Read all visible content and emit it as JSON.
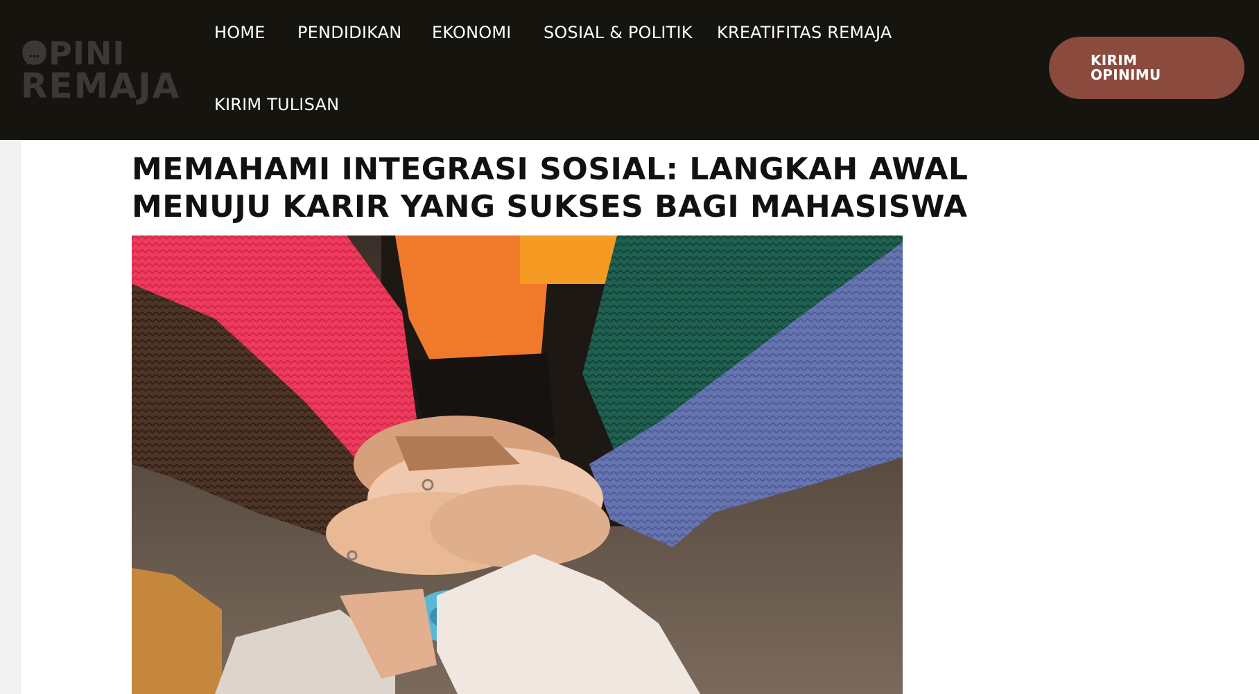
{
  "logo": {
    "line1": "OPINI",
    "line2": "REMAJA",
    "pin_dots": "..."
  },
  "nav": {
    "items": [
      {
        "label": "HOME"
      },
      {
        "label": "PENDIDIKAN"
      },
      {
        "label": "EKONOMI"
      },
      {
        "label": "SOSIAL & POLITIK"
      },
      {
        "label": "KREATIFITAS REMAJA"
      },
      {
        "label": "KIRIM TULISAN"
      }
    ]
  },
  "cta": {
    "label": "KIRIM OPINIMU"
  },
  "article": {
    "title": "MEMAHAMI INTEGRASI SOSIAL: LANGKAH AWAL MENUJU KARIR YANG SUKSES BAGI MAHASISWA"
  },
  "colors": {
    "header_bg": "#16140f",
    "cta_bg": "#8a4a3d",
    "page_bg": "#f1f2f1",
    "panel_bg": "#ffffff"
  }
}
